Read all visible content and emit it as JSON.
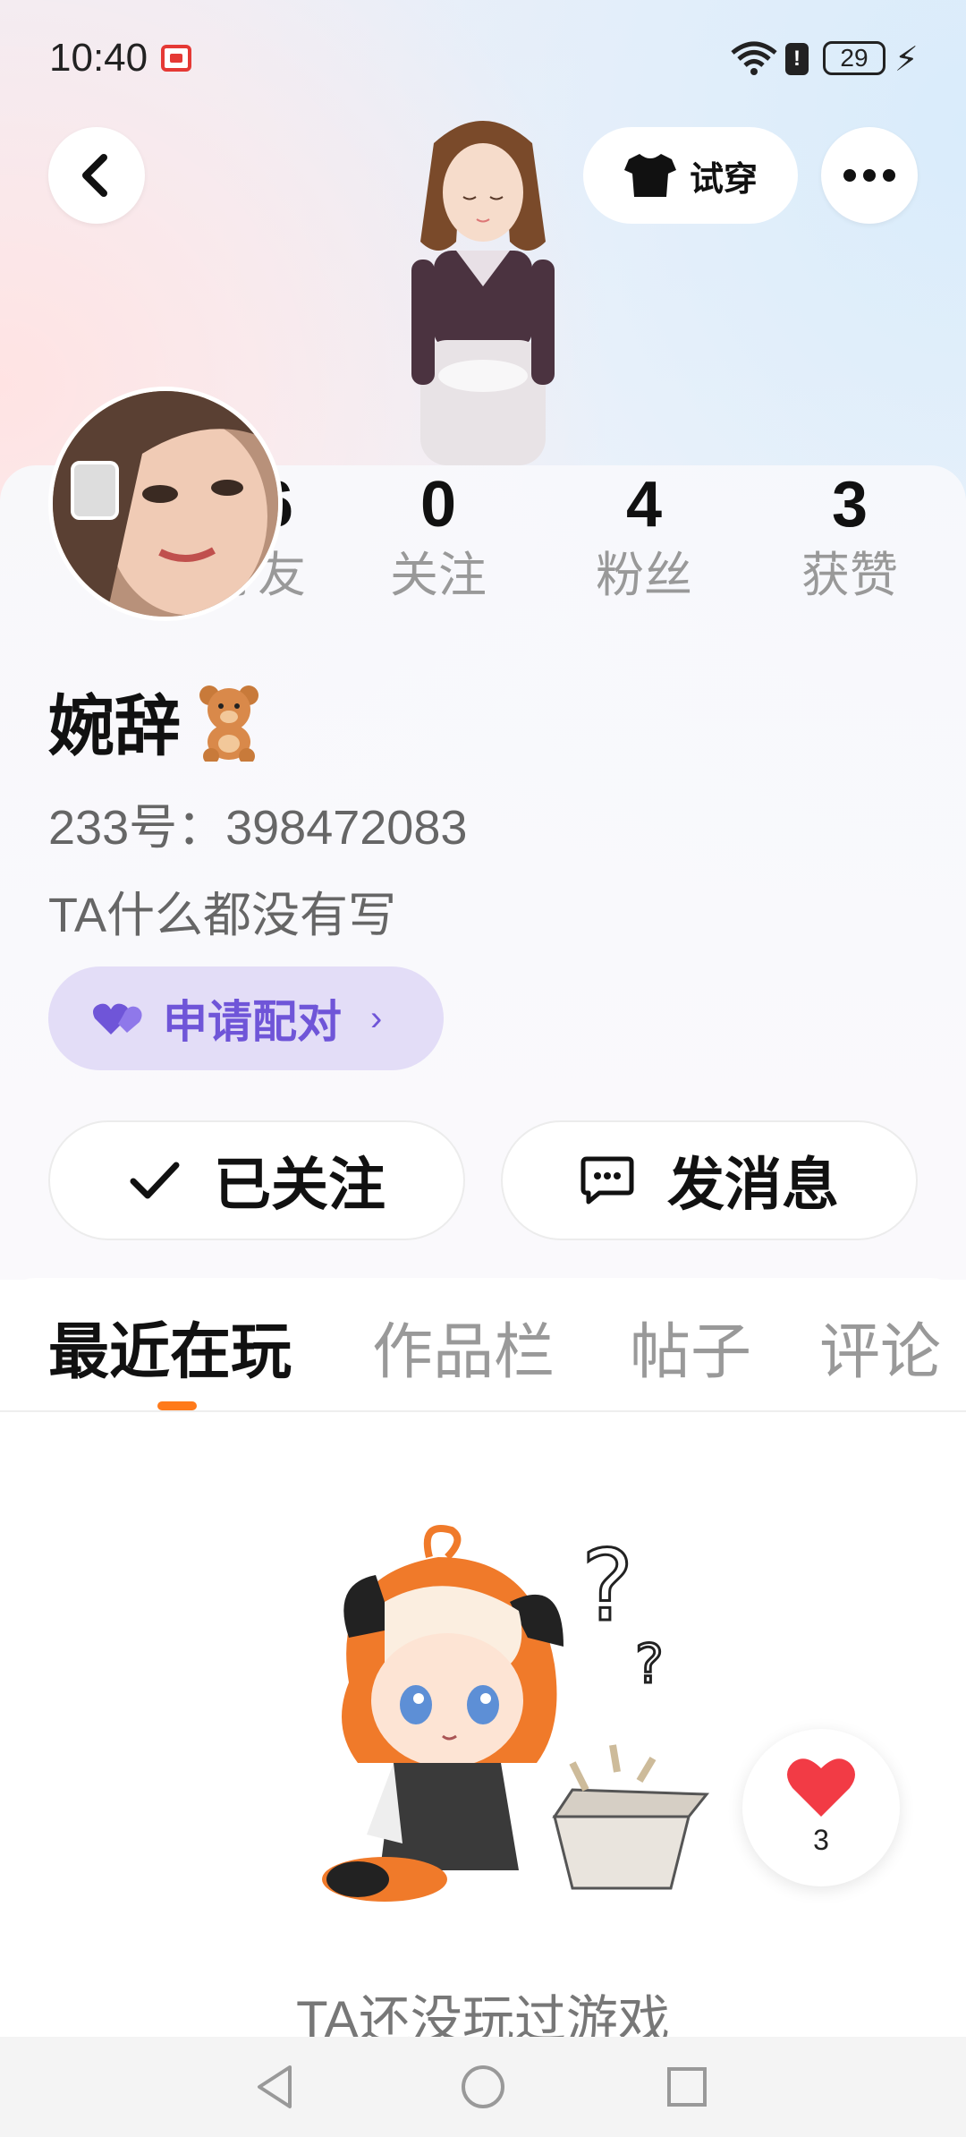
{
  "status_bar": {
    "time": "10:40",
    "battery": "29"
  },
  "header": {
    "tryon_label": "试穿"
  },
  "stats": [
    {
      "value": "66",
      "label": "好友"
    },
    {
      "value": "0",
      "label": "关注"
    },
    {
      "value": "4",
      "label": "粉丝"
    },
    {
      "value": "3",
      "label": "获赞"
    }
  ],
  "profile": {
    "name": "婉辞",
    "id_line": "233号：398472083",
    "bio": "TA什么都没有写",
    "pair_label": "申请配对"
  },
  "actions": {
    "follow_label": "已关注",
    "message_label": "发消息"
  },
  "tabs": [
    {
      "label": "最近在玩",
      "active": true
    },
    {
      "label": "作品栏",
      "active": false
    },
    {
      "label": "帖子",
      "active": false
    },
    {
      "label": "评论",
      "active": false
    }
  ],
  "empty_state": {
    "text": "TA还没玩过游戏"
  },
  "like": {
    "count": "3"
  },
  "colors": {
    "accent_orange": "#ff7a1a",
    "pair_purple": "#6f55d8",
    "heart_red": "#f23b45"
  }
}
